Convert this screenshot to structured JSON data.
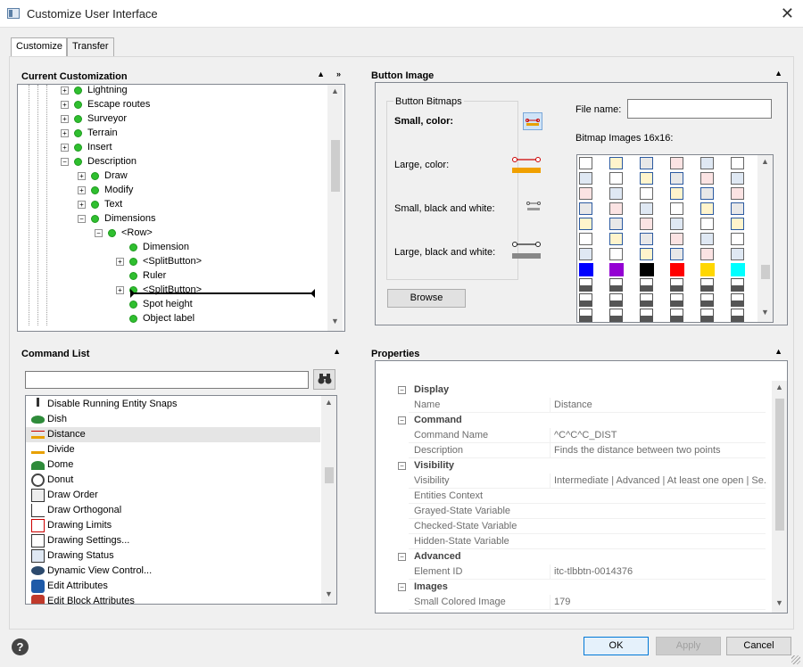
{
  "window": {
    "title": "Customize User Interface"
  },
  "tabs": [
    {
      "label": "Customize"
    },
    {
      "label": "Transfer"
    }
  ],
  "current_customization": {
    "title": "Current Customization",
    "tree": [
      {
        "label": "Lightning",
        "depth": 0,
        "expander": "+"
      },
      {
        "label": "Escape routes",
        "depth": 0,
        "expander": "+"
      },
      {
        "label": "Surveyor",
        "depth": 0,
        "expander": "+"
      },
      {
        "label": "Terrain",
        "depth": 0,
        "expander": "+"
      },
      {
        "label": "Insert",
        "depth": 0,
        "expander": "+"
      },
      {
        "label": "Description",
        "depth": 0,
        "expander": "-"
      },
      {
        "label": "Draw",
        "depth": 1,
        "expander": "+"
      },
      {
        "label": "Modify",
        "depth": 1,
        "expander": "+"
      },
      {
        "label": "Text",
        "depth": 1,
        "expander": "+"
      },
      {
        "label": "Dimensions",
        "depth": 1,
        "expander": "-"
      },
      {
        "label": "<Row>",
        "depth": 2,
        "expander": "-"
      },
      {
        "label": "Dimension",
        "depth": 3,
        "expander": ""
      },
      {
        "label": "<SplitButton>",
        "depth": 3,
        "expander": "+"
      },
      {
        "label": "Ruler",
        "depth": 3,
        "expander": ""
      },
      {
        "label": "<SplitButton>",
        "depth": 3,
        "expander": "+"
      },
      {
        "label": "Spot height",
        "depth": 3,
        "expander": ""
      },
      {
        "label": "Object label",
        "depth": 3,
        "expander": ""
      }
    ]
  },
  "command_list": {
    "title": "Command List",
    "search_value": "",
    "items": [
      {
        "label": "Disable Running Entity Snaps",
        "icon": "running-figure-icon"
      },
      {
        "label": "Dish",
        "icon": "dish-icon"
      },
      {
        "label": "Distance",
        "icon": "distance-icon",
        "selected": true
      },
      {
        "label": "Divide",
        "icon": "divide-icon"
      },
      {
        "label": "Dome",
        "icon": "dome-icon"
      },
      {
        "label": "Donut",
        "icon": "donut-icon"
      },
      {
        "label": "Draw Order",
        "icon": "draw-order-icon"
      },
      {
        "label": "Draw Orthogonal",
        "icon": "orthogonal-icon"
      },
      {
        "label": "Drawing Limits",
        "icon": "limits-icon"
      },
      {
        "label": "Drawing Settings...",
        "icon": "settings-icon"
      },
      {
        "label": "Drawing Status",
        "icon": "status-icon"
      },
      {
        "label": "Dynamic View Control...",
        "icon": "eye-icon"
      },
      {
        "label": "Edit Attributes",
        "icon": "edit-attributes-icon"
      },
      {
        "label": "Edit Block Attributes",
        "icon": "edit-block-icon"
      }
    ]
  },
  "button_image": {
    "title": "Button Image",
    "bitmaps_group": "Button Bitmaps",
    "small_color": "Small, color:",
    "large_color": "Large, color:",
    "small_bw": "Small, black and white:",
    "large_bw": "Large, black and white:",
    "browse_label": "Browse",
    "file_name_label": "File name:",
    "file_name_value": "",
    "bitmap_images_label": "Bitmap Images 16x16:",
    "colors": [
      "#0000ff",
      "#9400d3",
      "#000000",
      "#ff0000",
      "#ffd700",
      "#00ff00",
      "#00ffff"
    ]
  },
  "properties": {
    "title": "Properties",
    "sections": [
      {
        "category": "Display",
        "rows": [
          {
            "name": "Name",
            "value": "Distance"
          }
        ]
      },
      {
        "category": "Command",
        "rows": [
          {
            "name": "Command Name",
            "value": "^C^C^C_DIST"
          },
          {
            "name": "Description",
            "value": "Finds the distance between two points"
          }
        ]
      },
      {
        "category": "Visibility",
        "rows": [
          {
            "name": "Visibility",
            "value": "Intermediate | Advanced | At least one open | Se..."
          },
          {
            "name": "Entities Context",
            "value": ""
          },
          {
            "name": "Grayed-State Variable",
            "value": ""
          },
          {
            "name": "Checked-State Variable",
            "value": ""
          },
          {
            "name": "Hidden-State Variable",
            "value": ""
          }
        ]
      },
      {
        "category": "Advanced",
        "rows": [
          {
            "name": "Element ID",
            "value": "itc-tlbbtn-0014376"
          }
        ]
      },
      {
        "category": "Images",
        "rows": [
          {
            "name": "Small Colored Image",
            "value": "179"
          }
        ]
      }
    ]
  },
  "footer": {
    "ok_label": "OK",
    "apply_label": "Apply",
    "cancel_label": "Cancel"
  }
}
